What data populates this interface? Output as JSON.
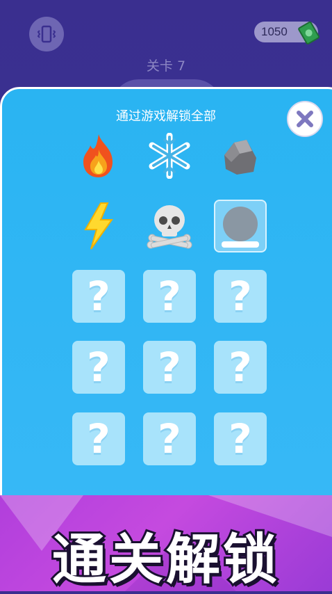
{
  "header": {
    "vibrate_icon": "vibrate-phone-icon",
    "coins": "1050",
    "cash_icon": "cash-icon",
    "level": "关卡 7"
  },
  "panel": {
    "title": "通过游戏解锁全部",
    "close_icon": "close-x-icon",
    "unlocked_items": [
      {
        "name": "fire-icon"
      },
      {
        "name": "snowflake-icon"
      },
      {
        "name": "rock-icon"
      },
      {
        "name": "lightning-icon"
      },
      {
        "name": "skull-icon"
      },
      {
        "name": "plain-ball-icon",
        "selected": true
      }
    ],
    "locked_slots": [
      "?",
      "?",
      "?",
      "?",
      "?",
      "?",
      "?",
      "?",
      "?"
    ]
  },
  "banner": {
    "text": "通关解锁"
  },
  "colors": {
    "background": "#3a2f8f",
    "panel": "#2ab4f2",
    "locked_slot": "#a8e3fb",
    "banner": "#b13fdc"
  }
}
